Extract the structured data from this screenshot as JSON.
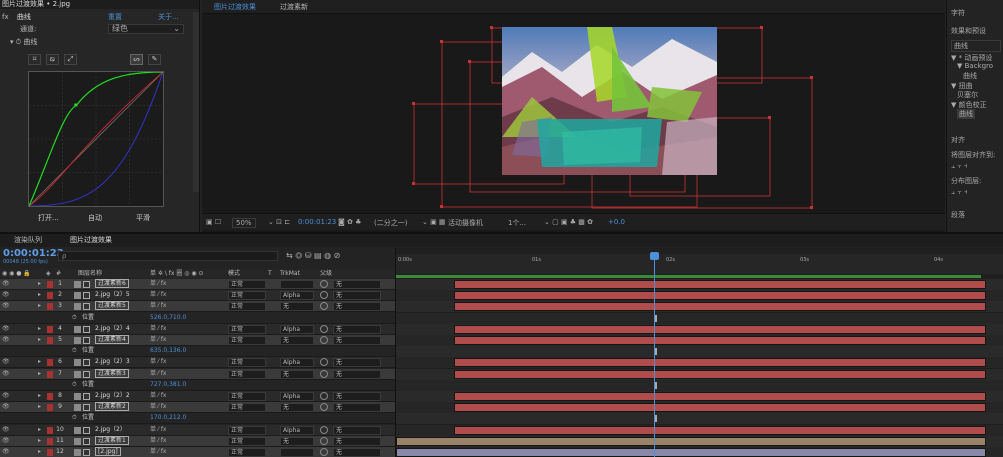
{
  "effect_controls": {
    "title": "图片过渡效果 • 2.jpg",
    "fx_label": "fx",
    "effect_name": "曲线",
    "reset_label": "重置",
    "about_label": "关于...",
    "channel_label": "通道:",
    "channel_value": "绿色",
    "curves_label": "曲线",
    "open_label": "打开...",
    "auto_label": "自动",
    "smooth_label": "平滑"
  },
  "viewer": {
    "tabs": [
      "图片过渡效果",
      "过渡素新"
    ],
    "zoom": "50%",
    "timecode": "0:00:01:23",
    "resolution": "(二分之一)",
    "camera": "活动摄像机",
    "views": "1个...",
    "exposure": "+0.0"
  },
  "right_panel": {
    "items": [
      "字符",
      "效果和预设",
      "曲线",
      "▼ * 动画预设",
      "▼ Backgro",
      "曲线",
      "▼ 扭曲",
      "贝塞尔",
      "▼ 颜色校正",
      "曲线",
      "对齐",
      "将图层对齐到:",
      "分布图层:",
      "段落"
    ]
  },
  "timeline": {
    "tabs": [
      "渲染队列",
      "图片过渡效果"
    ],
    "timecode": "0:00:01:23",
    "fps": "00048 (25.00 fps)",
    "search_placeholder": "ρ",
    "columns": {
      "label": "#",
      "name": "图层名称",
      "switches": "单 ✲ \\ fx 圈 ◎ ◉ ⊙",
      "mode": "模式",
      "t": "T",
      "trkmat": "TrkMat",
      "parent": "父级"
    },
    "ruler_ticks": [
      "0:00s",
      "01s",
      "02s",
      "03s",
      "04s"
    ],
    "rows": [
      {
        "kind": "layer",
        "num": "1",
        "name": "过渡素新6",
        "mode": "正常",
        "trkmat": "",
        "parent": "无",
        "boxed": true,
        "bar": "red",
        "bar_start": 0.095,
        "bar_end": 0.97
      },
      {
        "kind": "layer",
        "num": "2",
        "name": "2.jpg（2）5",
        "mode": "正常",
        "trkmat": "Alpha",
        "parent": "无",
        "boxed": false,
        "bar": "red",
        "bar_start": 0.095,
        "bar_end": 0.97
      },
      {
        "kind": "layer",
        "num": "3",
        "name": "过渡素新5",
        "mode": "正常",
        "trkmat": "无",
        "parent": "无",
        "boxed": true,
        "bar": "red",
        "bar_start": 0.095,
        "bar_end": 0.97
      },
      {
        "kind": "prop",
        "name": "位置",
        "value": "526.0,710.0",
        "kf": 0.425
      },
      {
        "kind": "layer",
        "num": "4",
        "name": "2.jpg（2）4",
        "mode": "正常",
        "trkmat": "Alpha",
        "parent": "无",
        "boxed": false,
        "bar": "red",
        "bar_start": 0.095,
        "bar_end": 0.97
      },
      {
        "kind": "layer",
        "num": "5",
        "name": "过渡素新4",
        "mode": "正常",
        "trkmat": "无",
        "parent": "无",
        "boxed": true,
        "bar": "red",
        "bar_start": 0.095,
        "bar_end": 0.97
      },
      {
        "kind": "prop",
        "name": "位置",
        "value": "635.0,136.0",
        "kf": 0.425
      },
      {
        "kind": "layer",
        "num": "6",
        "name": "2.jpg（2）3",
        "mode": "正常",
        "trkmat": "Alpha",
        "parent": "无",
        "boxed": false,
        "bar": "red",
        "bar_start": 0.095,
        "bar_end": 0.97
      },
      {
        "kind": "layer",
        "num": "7",
        "name": "过渡素新3",
        "mode": "正常",
        "trkmat": "无",
        "parent": "无",
        "boxed": true,
        "bar": "red",
        "bar_start": 0.095,
        "bar_end": 0.97
      },
      {
        "kind": "prop",
        "name": "位置",
        "value": "727.0,381.0",
        "kf": 0.425
      },
      {
        "kind": "layer",
        "num": "8",
        "name": "2.jpg（2）2",
        "mode": "正常",
        "trkmat": "Alpha",
        "parent": "无",
        "boxed": false,
        "bar": "red",
        "bar_start": 0.095,
        "bar_end": 0.97
      },
      {
        "kind": "layer",
        "num": "9",
        "name": "过渡素新2",
        "mode": "正常",
        "trkmat": "无",
        "parent": "无",
        "boxed": true,
        "bar": "red",
        "bar_start": 0.095,
        "bar_end": 0.97
      },
      {
        "kind": "prop",
        "name": "位置",
        "value": "170.0,212.0",
        "kf": 0.425
      },
      {
        "kind": "layer",
        "num": "10",
        "name": "2.jpg（2）",
        "mode": "正常",
        "trkmat": "Alpha",
        "parent": "无",
        "boxed": false,
        "bar": "red",
        "bar_start": 0.095,
        "bar_end": 0.97
      },
      {
        "kind": "layer",
        "num": "11",
        "name": "过渡素新1",
        "mode": "正常",
        "trkmat": "无",
        "parent": "无",
        "boxed": true,
        "bar": "tan",
        "bar_start": 0.0,
        "bar_end": 0.97
      },
      {
        "kind": "layer",
        "num": "12",
        "name": "[2.jpg]",
        "mode": "正常",
        "trkmat": "",
        "parent": "无",
        "boxed": true,
        "bar": "lav",
        "bar_start": 0.0,
        "bar_end": 0.97
      }
    ]
  },
  "colors": {
    "accent": "#4d8fd8",
    "layer_bar": "#b14c4c",
    "label_red": "#a83232",
    "curve_green": "#22dd22",
    "curve_red": "#c62828",
    "curve_blue": "#3333cc"
  }
}
